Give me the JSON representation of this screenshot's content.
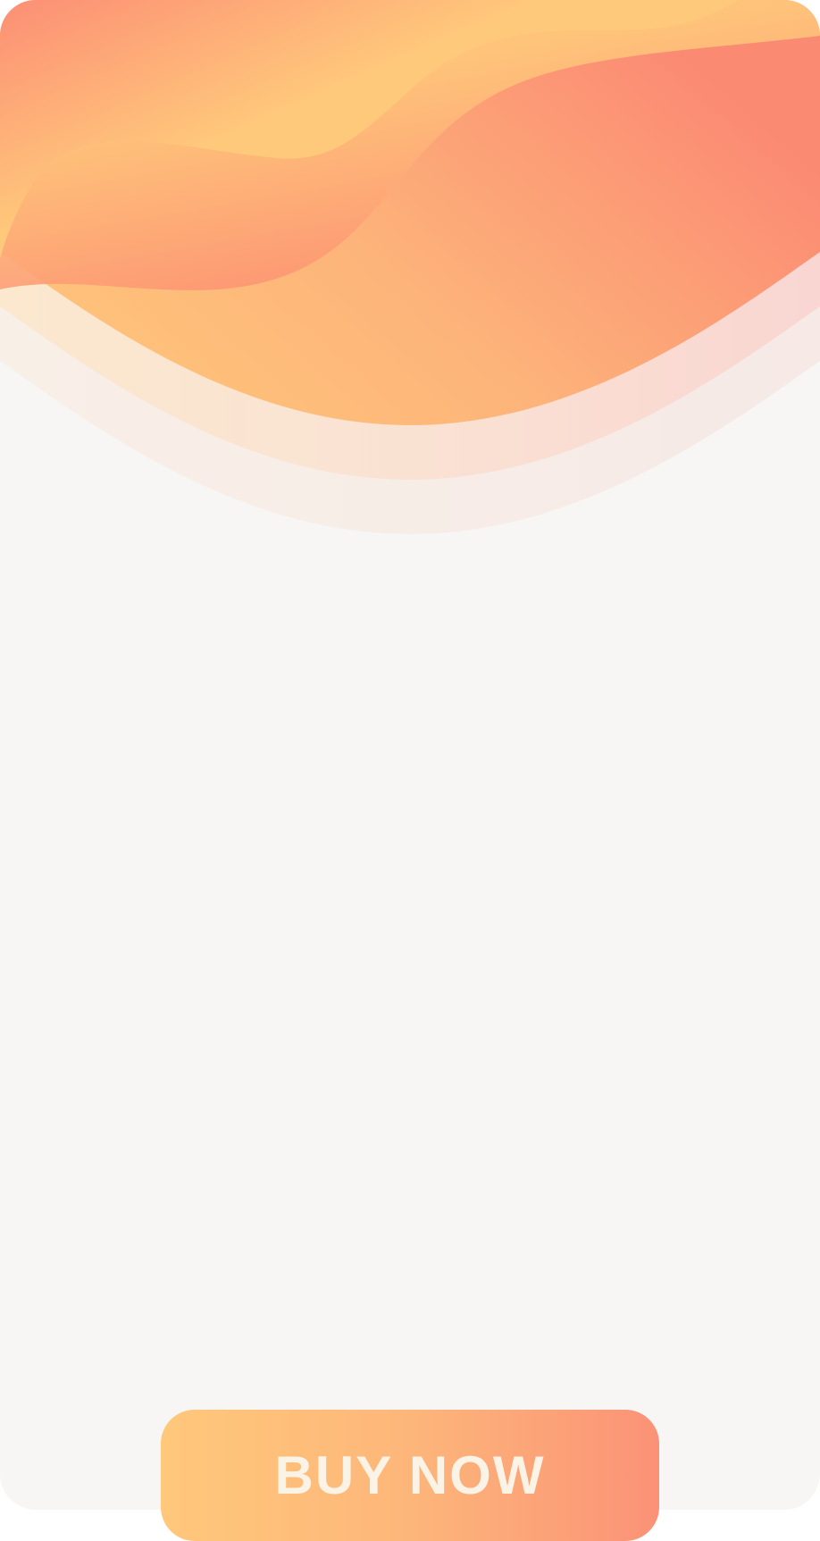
{
  "colors": {
    "background": "#f8f6f4",
    "gradient_yellow": "#ffc87b",
    "gradient_orange": "#fdb67a",
    "gradient_coral": "#fb8b73",
    "button_text": "#fbf3e6"
  },
  "cta": {
    "label": "BUY NOW"
  }
}
